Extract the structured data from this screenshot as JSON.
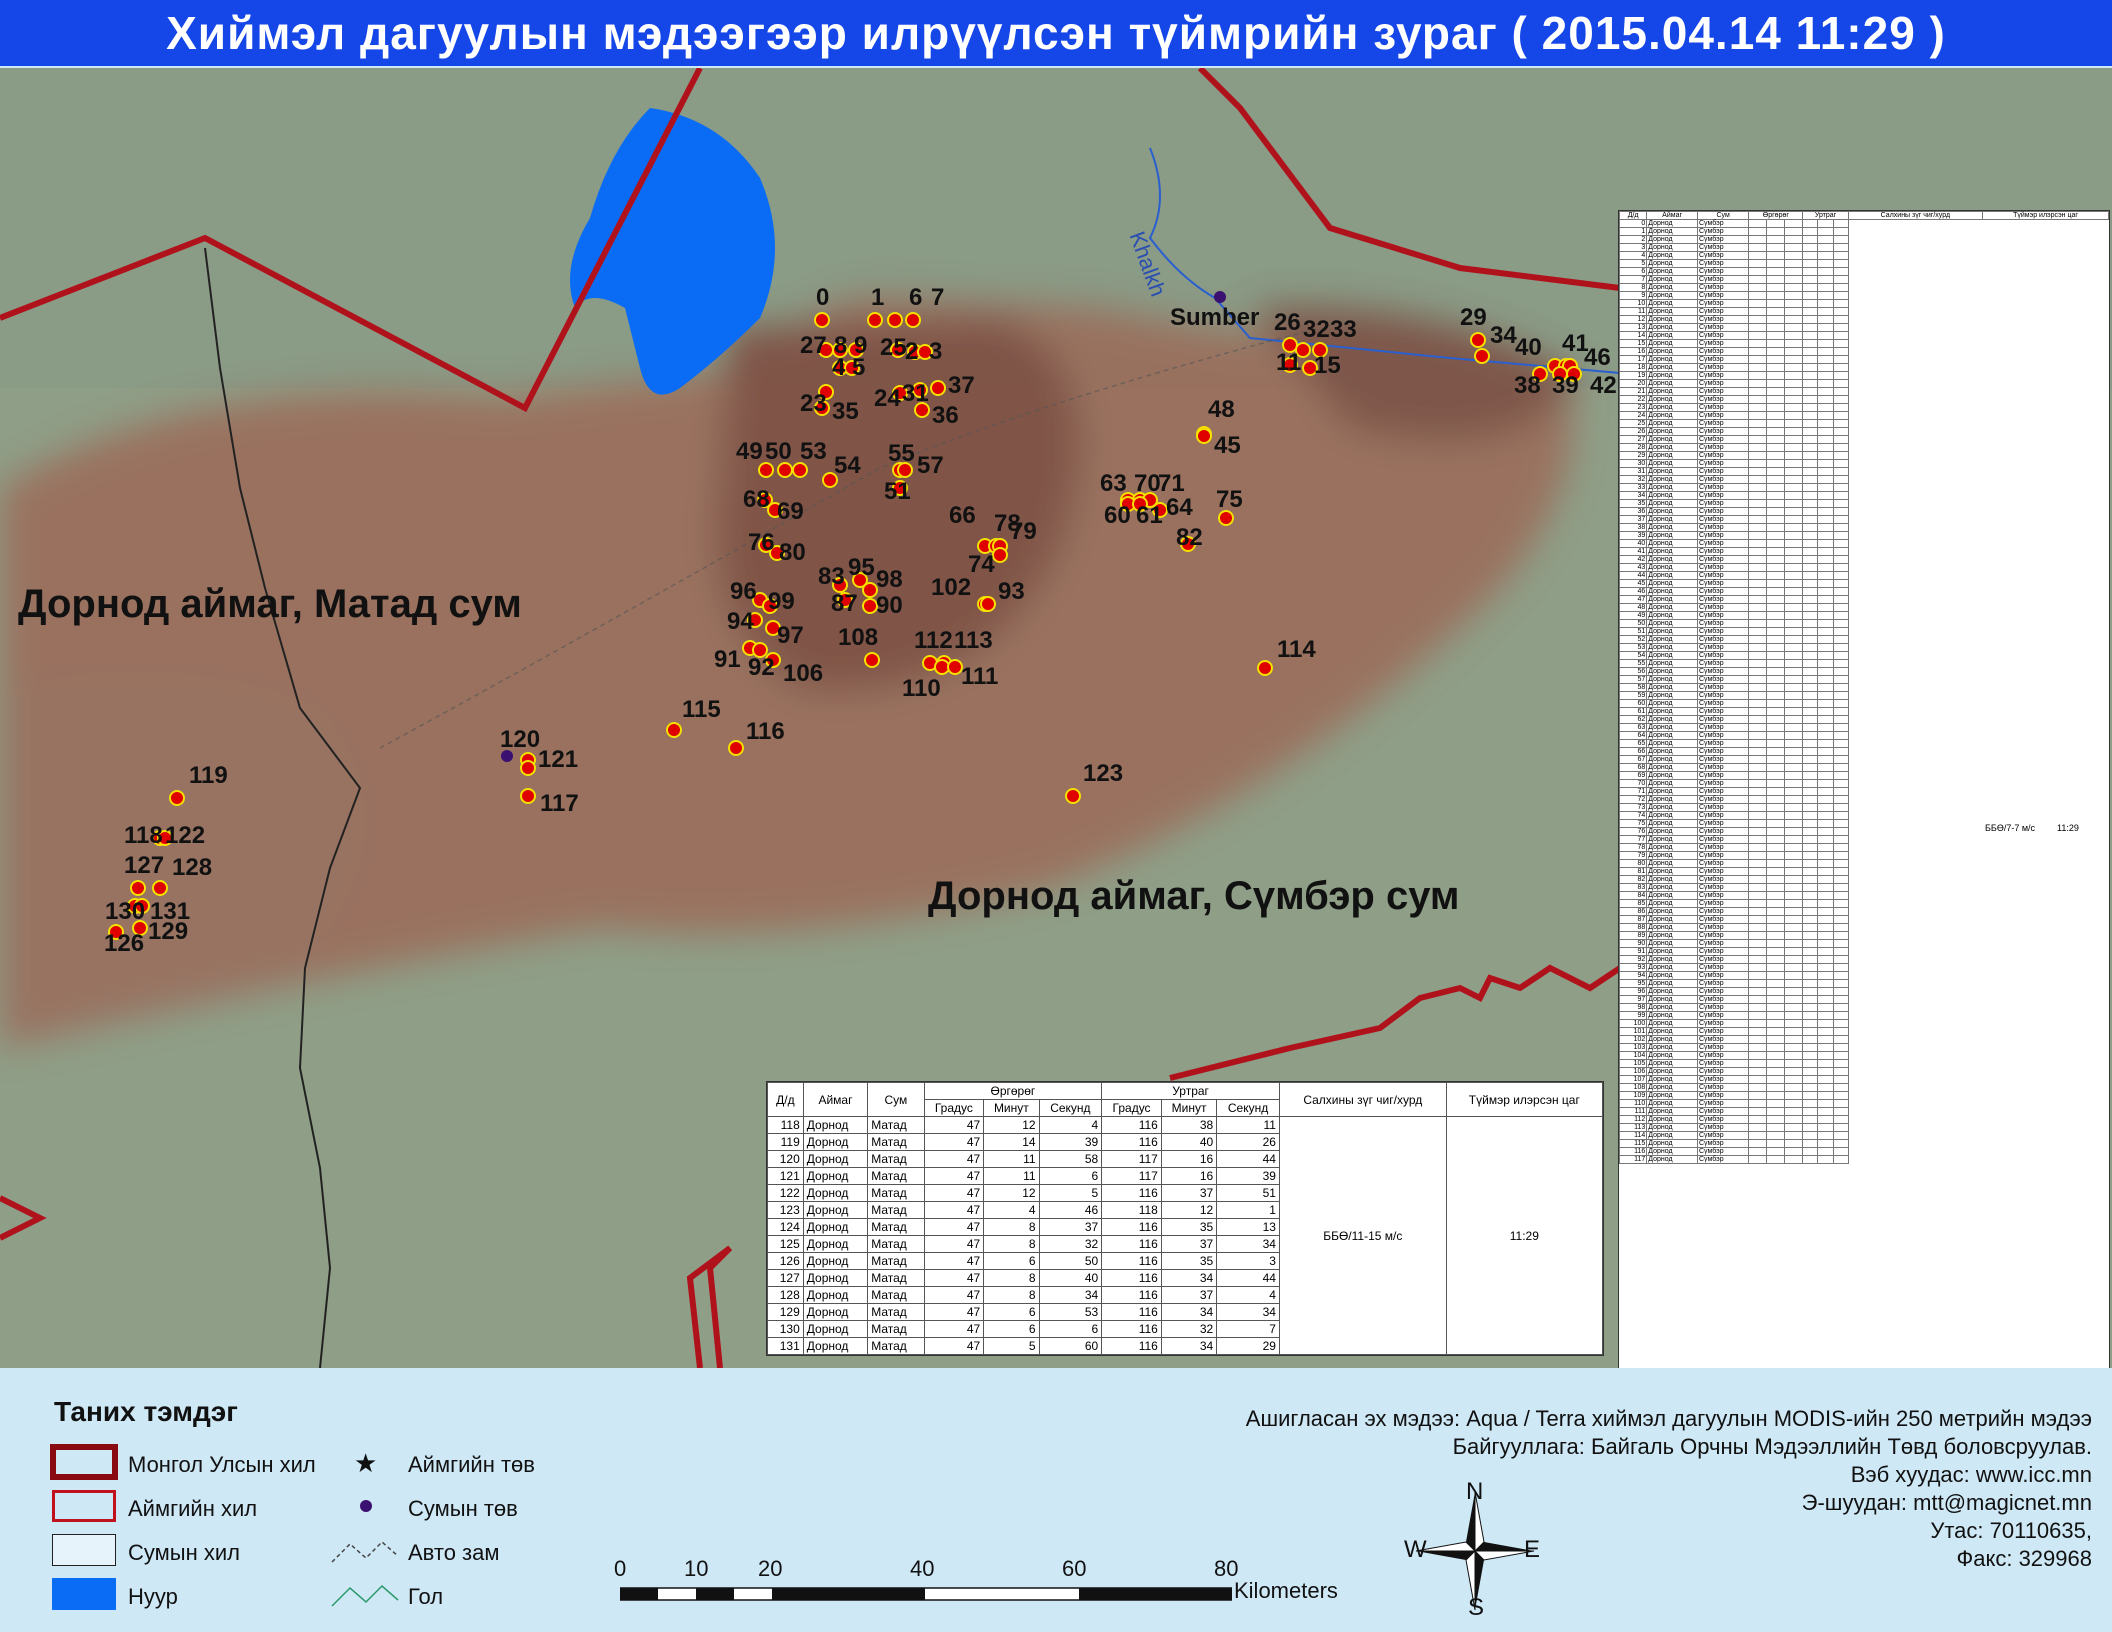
{
  "title": "Хиймэл дагуулын мэдээгээр илрүүлсэн түймрийн зураг  ( 2015.04.14  11:29 )",
  "regions": {
    "matad": "Дорнод аймаг, Матад сум",
    "sumber": "Дорнод аймаг, Сүмбэр сум"
  },
  "towns": {
    "sumber": "Sumber"
  },
  "river": "Khalkh",
  "colors": {
    "title_bar": "#1446e8",
    "lake": "#0a6cf5",
    "fire": "#e00000",
    "border": "#b0121c",
    "legend_bg": "#cfe8f6"
  },
  "fire_labels": [
    "0",
    "1",
    "6",
    "7",
    "27",
    "8",
    "9",
    "25",
    "2",
    "3",
    "4",
    "5",
    "24",
    "31",
    "37",
    "23",
    "35",
    "36",
    "49",
    "50",
    "53",
    "54",
    "55",
    "57",
    "51",
    "68",
    "69",
    "76",
    "80",
    "83",
    "95",
    "98",
    "87",
    "90",
    "96",
    "99",
    "94",
    "97",
    "91",
    "92",
    "106",
    "108",
    "112",
    "113",
    "110",
    "111",
    "102",
    "93",
    "66",
    "78",
    "79",
    "74",
    "63",
    "70",
    "71",
    "60",
    "61",
    "64",
    "82",
    "75",
    "48",
    "45",
    "26",
    "32",
    "33",
    "11",
    "15",
    "29",
    "34",
    "40",
    "41",
    "46",
    "38",
    "39",
    "42",
    "114",
    "115",
    "116",
    "120",
    "121",
    "117",
    "123",
    "119",
    "118",
    "122",
    "127",
    "128",
    "130",
    "131",
    "126",
    "129"
  ],
  "table": {
    "headers": {
      "id": "Д/д",
      "aimag": "Аймаг",
      "sum": "Сум",
      "lat": "Өргөрөг",
      "lon": "Уртраг",
      "deg": "Градус",
      "min": "Минут",
      "sec": "Секунд",
      "wind": "Салхины зүг чиг/хурд",
      "time": "Түймэр илэрсэн цаг"
    },
    "rows": [
      [
        "118",
        "Дорнод",
        "Матад",
        "47",
        "12",
        "4",
        "116",
        "38",
        "11"
      ],
      [
        "119",
        "Дорнод",
        "Матад",
        "47",
        "14",
        "39",
        "116",
        "40",
        "26"
      ],
      [
        "120",
        "Дорнод",
        "Матад",
        "47",
        "11",
        "58",
        "117",
        "16",
        "44"
      ],
      [
        "121",
        "Дорнод",
        "Матад",
        "47",
        "11",
        "6",
        "117",
        "16",
        "39"
      ],
      [
        "122",
        "Дорнод",
        "Матад",
        "47",
        "12",
        "5",
        "116",
        "37",
        "51"
      ],
      [
        "123",
        "Дорнод",
        "Матад",
        "47",
        "4",
        "46",
        "118",
        "12",
        "1"
      ],
      [
        "124",
        "Дорнод",
        "Матад",
        "47",
        "8",
        "37",
        "116",
        "35",
        "13"
      ],
      [
        "125",
        "Дорнод",
        "Матад",
        "47",
        "8",
        "32",
        "116",
        "37",
        "34"
      ],
      [
        "126",
        "Дорнод",
        "Матад",
        "47",
        "6",
        "50",
        "116",
        "35",
        "3"
      ],
      [
        "127",
        "Дорнод",
        "Матад",
        "47",
        "8",
        "40",
        "116",
        "34",
        "44"
      ],
      [
        "128",
        "Дорнод",
        "Матад",
        "47",
        "8",
        "34",
        "116",
        "37",
        "4"
      ],
      [
        "129",
        "Дорнод",
        "Матад",
        "47",
        "6",
        "53",
        "116",
        "34",
        "34"
      ],
      [
        "130",
        "Дорнод",
        "Матад",
        "47",
        "6",
        "6",
        "116",
        "32",
        "7"
      ],
      [
        "131",
        "Дорнод",
        "Матад",
        "47",
        "5",
        "60",
        "116",
        "34",
        "29"
      ]
    ],
    "wind": "ББӨ/11-15 м/с",
    "time": "11:29"
  },
  "side_table": {
    "aimag": "Дорнод",
    "sum": "Сүмбэр",
    "wind": "ББӨ/7-7 м/с",
    "time": "11:29"
  },
  "legend": {
    "title": "Таних тэмдэг",
    "items": [
      "Монгол Улсын хил",
      "Аймгийн хил",
      "Сумын хил",
      "Нуур",
      "Аймгийн төв",
      "Сумын төв",
      "Авто зам",
      "Гол"
    ]
  },
  "source": {
    "line1": "Ашигласан эх мэдээ: Aqua / Terra хиймэл дагуулын MODIS-ийн 250 метрийн мэдээ",
    "line2": "Байгууллага: Байгаль Орчны Мэдээллийн Төвд боловсруулав.",
    "line3": "Вэб хуудас: www.icc.mn",
    "line4": "Э-шуудан: mtt@magicnet.mn",
    "line5": "Утас: 70110635,",
    "line6": "Факс: 329968"
  },
  "scale": {
    "ticks": [
      "0",
      "10",
      "20",
      "40",
      "60",
      "80"
    ],
    "unit": "Kilometers"
  },
  "compass": {
    "n": "N",
    "s": "S",
    "e": "E",
    "w": "W"
  }
}
